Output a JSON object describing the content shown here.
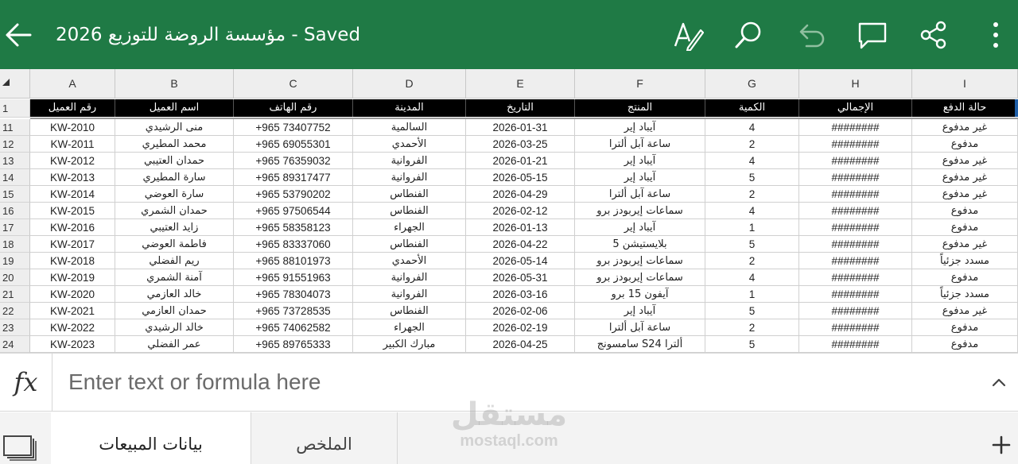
{
  "app": {
    "title": "مؤسسة الروضة للتوزيع 2026 - Saved",
    "bar_color": "#1f7a45",
    "icons": [
      "back-arrow-icon",
      "draw-pen-icon",
      "search-icon",
      "undo-icon",
      "comment-icon",
      "share-icon",
      "more-vertical-icon"
    ]
  },
  "columns": [
    "A",
    "B",
    "C",
    "D",
    "E",
    "F",
    "G",
    "H",
    "I"
  ],
  "header_row": {
    "row_number": "1",
    "cells": [
      "رقم العميل",
      "اسم العميل",
      "رقم الهاتف",
      "المدينة",
      "التاريخ",
      "المنتج",
      "الكمية",
      "الإجمالي",
      "حالة الدفع"
    ]
  },
  "rows": [
    {
      "n": "11",
      "cells": [
        "KW-2010",
        "منى الرشيدي",
        "+965 73407752",
        "السالمية",
        "2026-01-31",
        "آيباد إير",
        "4",
        "########",
        "غير مدفوع"
      ]
    },
    {
      "n": "12",
      "cells": [
        "KW-2011",
        "محمد المطيري",
        "+965 69055301",
        "الأحمدي",
        "2026-03-25",
        "ساعة آبل ألترا",
        "2",
        "########",
        "مدفوع"
      ]
    },
    {
      "n": "13",
      "cells": [
        "KW-2012",
        "حمدان العتيبي",
        "+965 76359032",
        "الفروانية",
        "2026-01-21",
        "آيباد إير",
        "4",
        "########",
        "غير مدفوع"
      ]
    },
    {
      "n": "14",
      "cells": [
        "KW-2013",
        "سارة المطيري",
        "+965 89317477",
        "الفروانية",
        "2026-05-15",
        "آيباد إير",
        "5",
        "########",
        "غير مدفوع"
      ]
    },
    {
      "n": "15",
      "cells": [
        "KW-2014",
        "سارة العوضي",
        "+965 53790202",
        "الفنطاس",
        "2026-04-29",
        "ساعة آبل ألترا",
        "2",
        "########",
        "غير مدفوع"
      ]
    },
    {
      "n": "16",
      "cells": [
        "KW-2015",
        "حمدان الشمري",
        "+965 97506544",
        "الفنطاس",
        "2026-02-12",
        "سماعات إيربودز برو",
        "4",
        "########",
        "مدفوع"
      ]
    },
    {
      "n": "17",
      "cells": [
        "KW-2016",
        "زايد العتيبي",
        "+965 58358123",
        "الجهراء",
        "2026-01-13",
        "آيباد إير",
        "1",
        "########",
        "مدفوع"
      ]
    },
    {
      "n": "18",
      "cells": [
        "KW-2017",
        "فاطمة العوضي",
        "+965 83337060",
        "الفنطاس",
        "2026-04-22",
        "بلايستيشن 5",
        "5",
        "########",
        "غير مدفوع"
      ]
    },
    {
      "n": "19",
      "cells": [
        "KW-2018",
        "ريم الفضلي",
        "+965 88101973",
        "الأحمدي",
        "2026-05-14",
        "سماعات إيربودز برو",
        "2",
        "########",
        "مسدد جزئياً"
      ]
    },
    {
      "n": "20",
      "cells": [
        "KW-2019",
        "آمنة الشمري",
        "+965 91551963",
        "الفروانية",
        "2026-05-31",
        "سماعات إيربودز برو",
        "4",
        "########",
        "مدفوع"
      ]
    },
    {
      "n": "21",
      "cells": [
        "KW-2020",
        "خالد العازمي",
        "+965 78304073",
        "الفروانية",
        "2026-03-16",
        "آيفون 15 برو",
        "1",
        "########",
        "مسدد جزئياً"
      ]
    },
    {
      "n": "22",
      "cells": [
        "KW-2021",
        "حمدان العازمي",
        "+965 73728535",
        "الفنطاس",
        "2026-02-06",
        "آيباد إير",
        "5",
        "########",
        "غير مدفوع"
      ]
    },
    {
      "n": "23",
      "cells": [
        "KW-2022",
        "خالد الرشيدي",
        "+965 74062582",
        "الجهراء",
        "2026-02-19",
        "ساعة آبل ألترا",
        "2",
        "########",
        "مدفوع"
      ]
    },
    {
      "n": "24",
      "cells": [
        "KW-2023",
        "عمر الفضلي",
        "+965 89765333",
        "مبارك الكبير",
        "2026-04-25",
        "سامسونج S24 ألترا",
        "5",
        "########",
        "مدفوع"
      ]
    }
  ],
  "formula_bar": {
    "fx_label": "fx",
    "placeholder": "Enter text or formula here"
  },
  "sheet_tabs": [
    {
      "label": "بيانات المبيعات",
      "active": true
    },
    {
      "label": "الملخص",
      "active": false
    }
  ],
  "watermark": {
    "line1": "مستقل",
    "line2": "mostaql.com"
  }
}
